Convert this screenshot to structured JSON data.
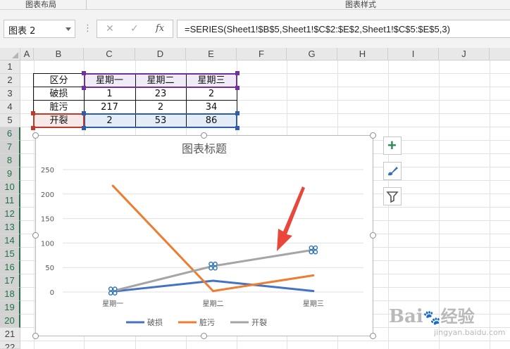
{
  "ribbon": {
    "group_left": "图表布局",
    "group_right": "图表样式"
  },
  "formula_bar": {
    "name_box": "图表 2",
    "dots": "⋮",
    "cancel": "✕",
    "enter": "✓",
    "fx": "fx",
    "formula": "=SERIES(Sheet1!$B$5,Sheet1!$C$2:$E$2,Sheet1!$C$5:$E$5,3)"
  },
  "columns": [
    "A",
    "B",
    "C",
    "D",
    "E",
    "F",
    "G",
    "H",
    "I",
    "J"
  ],
  "rows": [
    "1",
    "2",
    "3",
    "4",
    "5",
    "6",
    "7",
    "8",
    "9",
    "10",
    "11",
    "12",
    "13",
    "14",
    "15",
    "16",
    "17",
    "18",
    "19",
    "20",
    "21",
    "22"
  ],
  "table": {
    "header": [
      "区分",
      "星期一",
      "星期二",
      "星期三"
    ],
    "rows": [
      [
        "破损",
        "1",
        "23",
        "2"
      ],
      [
        "脏污",
        "217",
        "2",
        "34"
      ],
      [
        "开裂",
        "2",
        "53",
        "86"
      ]
    ]
  },
  "chart_data": {
    "type": "line",
    "title": "图表标题",
    "categories": [
      "星期一",
      "星期二",
      "星期三"
    ],
    "series": [
      {
        "name": "破损",
        "values": [
          1,
          23,
          2
        ],
        "color": "#4472c4"
      },
      {
        "name": "脏污",
        "values": [
          217,
          2,
          34
        ],
        "color": "#ed7d31"
      },
      {
        "name": "开裂",
        "values": [
          2,
          53,
          86
        ],
        "color": "#a5a5a5"
      }
    ],
    "yticks": [
      "250",
      "200",
      "150",
      "100",
      "50",
      "0"
    ],
    "ylim": [
      0,
      250
    ],
    "grid": true,
    "legend": "bottom",
    "selected_series": "开裂"
  },
  "chart_tools": {
    "add_elements": "+",
    "styles": "brush-icon",
    "filters": "funnel-icon"
  },
  "colors": {
    "selected_header": "#217346",
    "range_purple": "#7030a0",
    "range_blue": "#2e5ea8",
    "range_red": "#c0392b",
    "arrow": "#e8473a"
  },
  "watermark": {
    "logo": "Bai",
    "brand": "经验",
    "url": "jingyan.baidu.com"
  }
}
